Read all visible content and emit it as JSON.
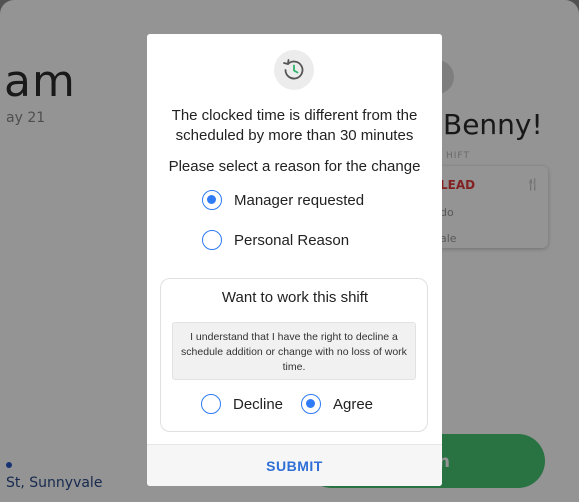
{
  "background": {
    "time_fragment": "am",
    "date_fragment": "ay 21",
    "address_fragment": "St, Sunnyvale",
    "greeting_fragment": "Benny!",
    "shift_label": "HIFT",
    "role_fragment": "LEAD",
    "card_line_2": "do",
    "card_line_3": "ale",
    "clock_button_fragment": "in"
  },
  "modal": {
    "icon": "history-clock-icon",
    "message_line_1": "The clocked time is different from the",
    "message_line_2": "scheduled by more than 30 minutes",
    "prompt": "Please select a reason for the change",
    "reasons": [
      {
        "label": "Manager requested",
        "selected": true
      },
      {
        "label": "Personal Reason",
        "selected": false
      }
    ],
    "shift_card": {
      "title": "Want to work this shift",
      "notice": "I understand that I have the right to decline a schedule addition or change with no loss of work time.",
      "options": [
        {
          "label": "Decline",
          "selected": false
        },
        {
          "label": "Agree",
          "selected": true
        }
      ]
    },
    "submit_label": "SUBMIT"
  },
  "colors": {
    "accent": "#2f7cf6",
    "submit_text": "#2f6fd6",
    "clock_button": "#47c572",
    "lead_red": "#e03a3a"
  }
}
